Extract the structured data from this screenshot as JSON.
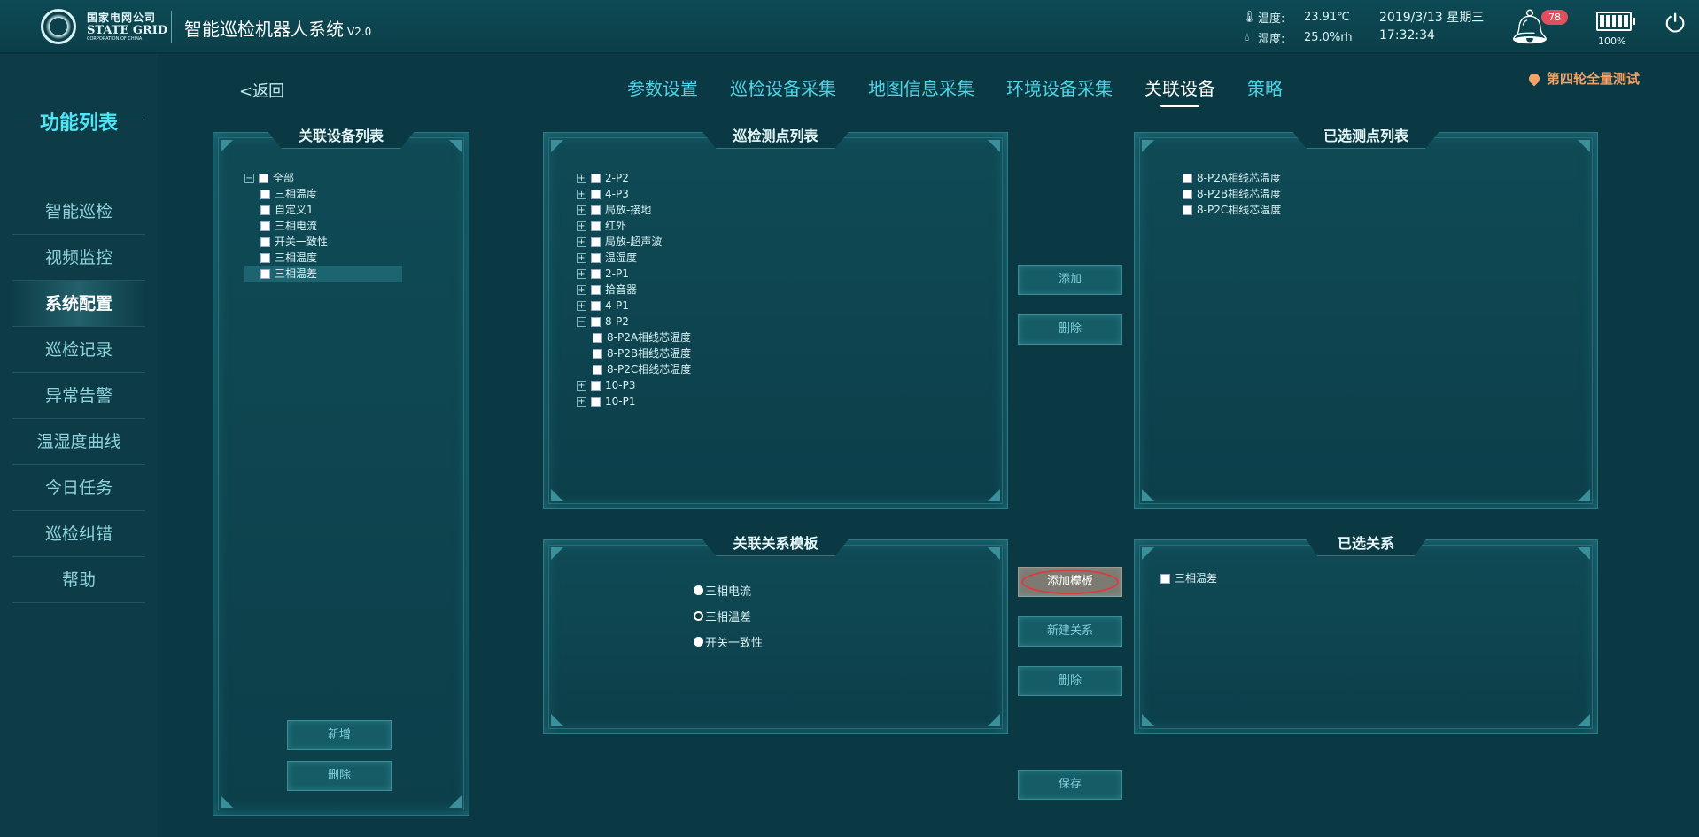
{
  "header": {
    "logo_cn": "国家电网公司",
    "logo_en": "STATE GRID",
    "logo_sub": "CORPORATION OF CHINA",
    "title": "智能巡检机器人系统",
    "version": "V2.0",
    "temperature_label": "温度:",
    "temperature_value": "23.91℃",
    "humidity_label": "湿度:",
    "humidity_value": "25.0%rh",
    "date": "2019/3/13 星期三",
    "time": "17:32:34",
    "alarm_count": "78",
    "battery_percent": "100%",
    "battery_level": 1.0
  },
  "sidebar": {
    "title": "功能列表",
    "items": [
      {
        "label": "智能巡检"
      },
      {
        "label": "视频监控"
      },
      {
        "label": "系统配置"
      },
      {
        "label": "巡检记录"
      },
      {
        "label": "异常告警"
      },
      {
        "label": "温湿度曲线"
      },
      {
        "label": "今日任务"
      },
      {
        "label": "巡检纠错"
      },
      {
        "label": "帮助"
      }
    ]
  },
  "main": {
    "back_label": "<返回",
    "tabs": [
      {
        "label": "参数设置"
      },
      {
        "label": "巡检设备采集"
      },
      {
        "label": "地图信息采集"
      },
      {
        "label": "环境设备采集"
      },
      {
        "label": "关联设备"
      },
      {
        "label": "策略"
      }
    ],
    "location": "第四轮全量测试"
  },
  "device_list": {
    "title": "关联设备列表",
    "root": "全部",
    "items": [
      "三相温度",
      "自定义1",
      "三相电流",
      "开关一致性",
      "三相温度",
      "三相温差"
    ],
    "add_button": "新增",
    "delete_button": "删除"
  },
  "point_list": {
    "title": "巡检测点列表",
    "items": [
      "2-P2",
      "4-P3",
      "局放-接地",
      "红外",
      "局放-超声波",
      "温湿度",
      "2-P1",
      "拾音器",
      "4-P1",
      "8-P2"
    ],
    "children": [
      "8-P2A相线芯温度",
      "8-P2B相线芯温度",
      "8-P2C相线芯温度"
    ],
    "tail": [
      "10-P3",
      "10-P1"
    ]
  },
  "middle_buttons": {
    "add": "添加",
    "delete": "删除",
    "add_template": "添加模板",
    "new_relation": "新建关系",
    "delete2": "删除",
    "save": "保存"
  },
  "selected_points": {
    "title": "已选测点列表",
    "items": [
      "8-P2A相线芯温度",
      "8-P2B相线芯温度",
      "8-P2C相线芯温度"
    ]
  },
  "template": {
    "title": "关联关系模板",
    "options": [
      "三相电流",
      "三相温差",
      "开关一致性"
    ],
    "selected": "三相温差"
  },
  "selected_relations": {
    "title": "已选关系",
    "items": [
      "三相温差"
    ]
  }
}
